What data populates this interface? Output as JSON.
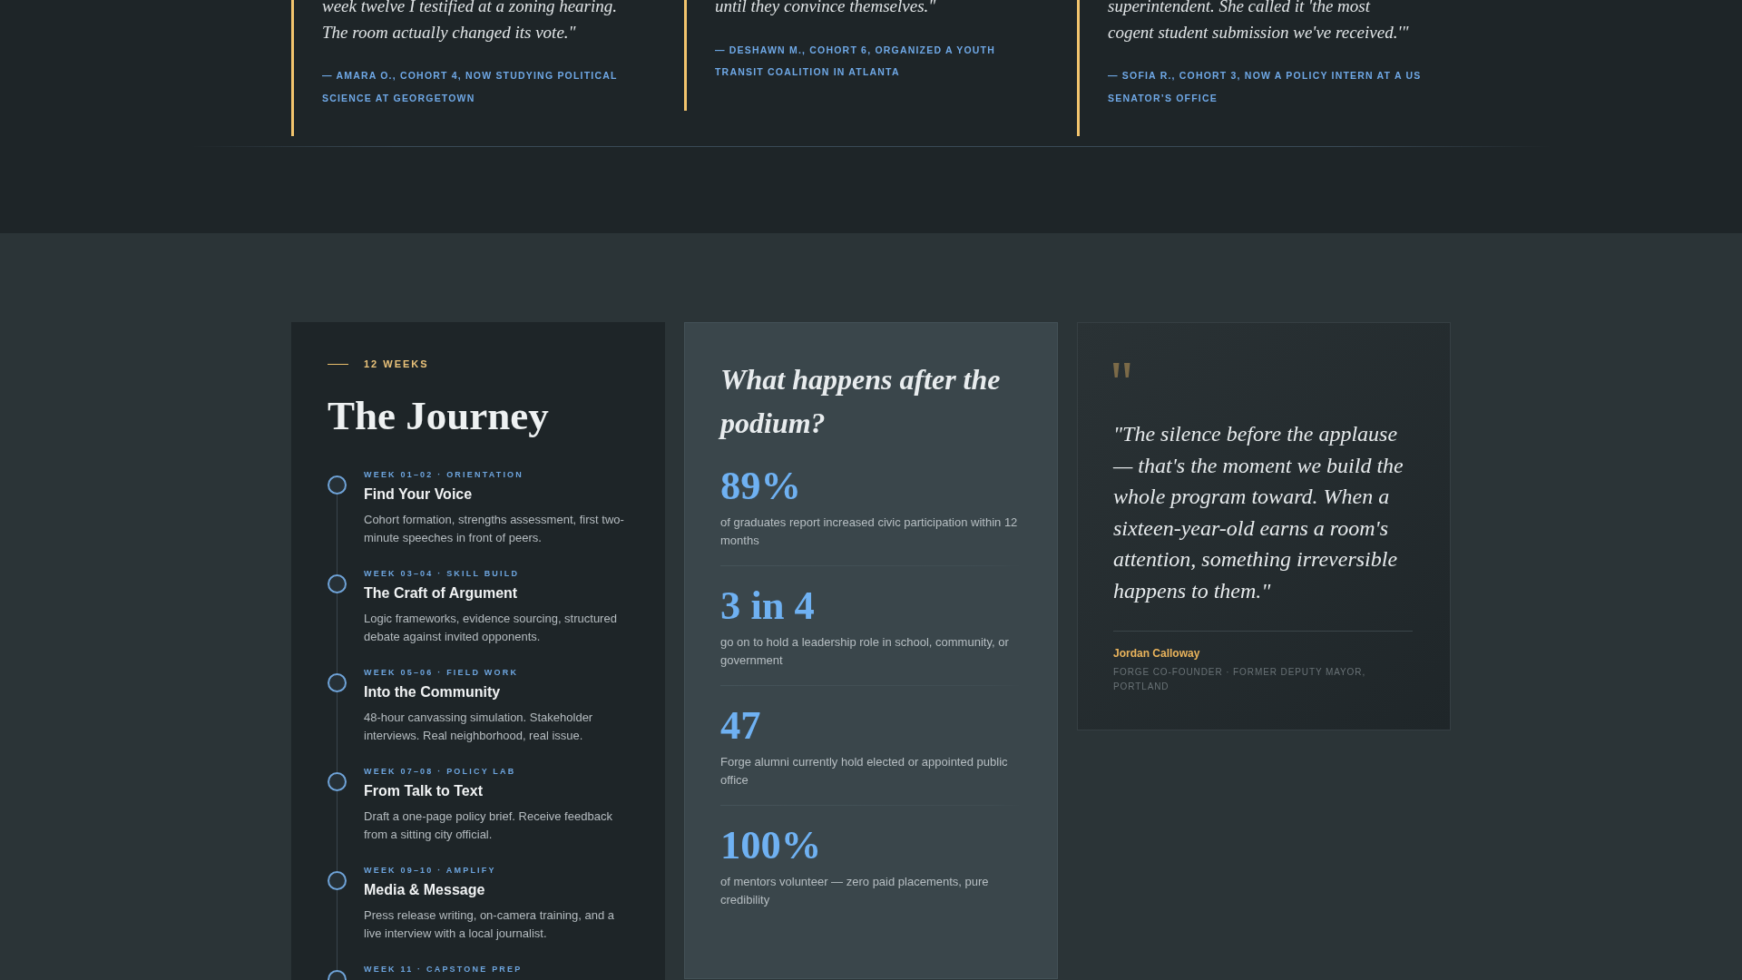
{
  "testimonials": [
    {
      "quote": "week twelve I testified at a zoning hearing. The room actually changed its vote.\"",
      "attribution": "— AMARA O., COHORT 4, NOW STUDYING POLITICAL SCIENCE AT GEORGETOWN"
    },
    {
      "quote": "until they convince themselves.\"",
      "attribution": "— DESHAWN M., COHORT 6, ORGANIZED A YOUTH TRANSIT COALITION IN ATLANTA"
    },
    {
      "quote": "superintendent. She called it 'the most cogent student submission we've received.'\"",
      "attribution": "— SOFIA R., COHORT 3, NOW A POLICY INTERN AT A US SENATOR’S OFFICE"
    }
  ],
  "journey": {
    "eyebrow": "12 WEEKS",
    "title": "The Journey",
    "steps": [
      {
        "label": "WEEK 01–02 · ORIENTATION",
        "title": "Find Your Voice",
        "description": "Cohort formation, strengths assessment, first two-minute speeches in front of peers."
      },
      {
        "label": "WEEK 03–04 · SKILL BUILD",
        "title": "The Craft of Argument",
        "description": "Logic frameworks, evidence sourcing, structured debate against invited opponents."
      },
      {
        "label": "WEEK 05–06 · FIELD WORK",
        "title": "Into the Community",
        "description": "48-hour canvassing simulation. Stakeholder interviews. Real neighborhood, real issue."
      },
      {
        "label": "WEEK 07–08 · POLICY LAB",
        "title": "From Talk to Text",
        "description": "Draft a one-page policy brief. Receive feedback from a sitting city official."
      },
      {
        "label": "WEEK 09–10 · AMPLIFY",
        "title": "Media & Message",
        "description": "Press release writing, on-camera training, and a live interview with a local journalist."
      },
      {
        "label": "WEEK 11 · CAPSTONE PREP"
      }
    ]
  },
  "outcomes": {
    "title": "What happens after the podium?",
    "stats": [
      {
        "value": "89%",
        "description": "of graduates report increased civic participation within 12 months"
      },
      {
        "value": "3 in 4",
        "description": "go on to hold a leadership role in school, community, or government"
      },
      {
        "value": "47",
        "description": "Forge alumni currently hold elected or appointed public office"
      },
      {
        "value": "100%",
        "description": "of mentors volunteer — zero paid placements, pure credibility"
      }
    ]
  },
  "spotlight": {
    "quote": "\"The silence before the applause — that's the moment we build the whole program toward. When a sixteen-year-old earns a room's attention, something irreversible happens to them.\"",
    "name": "Jordan Calloway",
    "role": "FORGE CO-FOUNDER · FORMER DEPUTY MAYOR, PORTLAND"
  }
}
